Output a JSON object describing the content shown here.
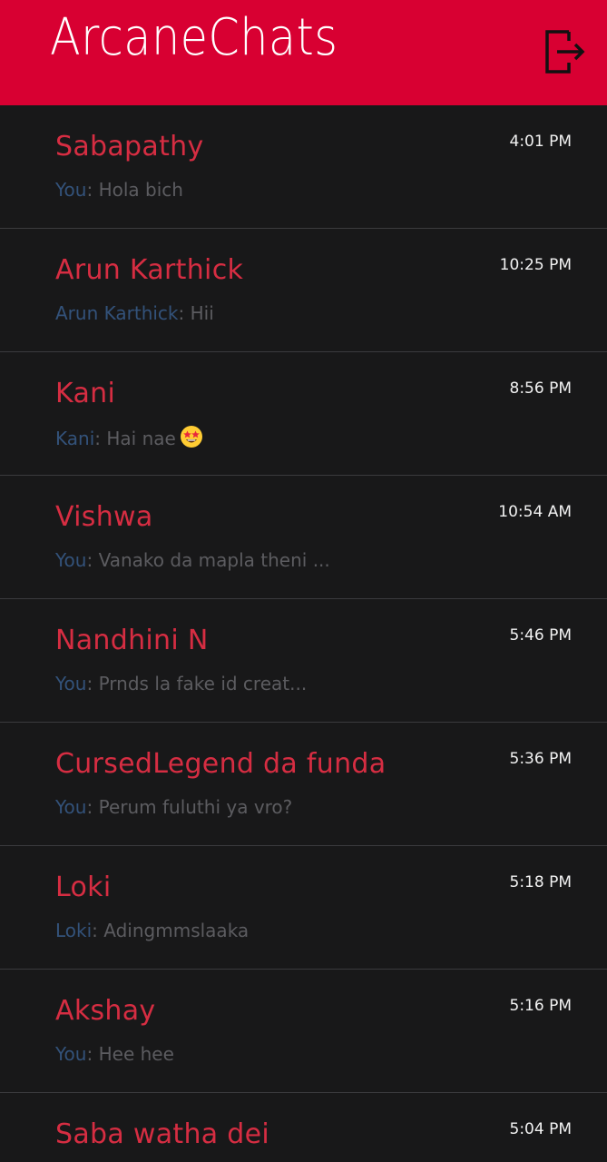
{
  "header": {
    "title": "ArcaneChats",
    "logout_icon": "logout-icon",
    "background": "#d80032"
  },
  "chats": [
    {
      "name": "Sabapathy",
      "time": "4:01 PM",
      "sender": "You",
      "message": "Hola bich"
    },
    {
      "name": "Arun Karthick",
      "time": "10:25 PM",
      "sender": "Arun Karthick",
      "message": "Hii"
    },
    {
      "name": "Kani",
      "time": "8:56 PM",
      "sender": "Kani",
      "message": "Hai nae",
      "emoji": "star-struck-emoji"
    },
    {
      "name": "Vishwa",
      "time": "10:54 AM",
      "sender": "You",
      "message": "Vanako da mapla theni ..."
    },
    {
      "name": "Nandhini N",
      "time": "5:46 PM",
      "sender": "You",
      "message": "Prnds la fake id creat..."
    },
    {
      "name": "CursedLegend da funda",
      "time": "5:36 PM",
      "sender": "You",
      "message": "Perum fuluthi ya vro?"
    },
    {
      "name": "Loki",
      "time": "5:18 PM",
      "sender": "Loki",
      "message": "Adingmmslaaka"
    },
    {
      "name": "Akshay",
      "time": "5:16 PM",
      "sender": "You",
      "message": "Hee hee"
    },
    {
      "name": "Saba watha dei",
      "time": "5:04 PM",
      "sender": "",
      "message": ""
    }
  ],
  "colors": {
    "accent": "#d80032",
    "name": "#d62d42",
    "sender": "#33527a",
    "preview": "#5c5c60",
    "background": "#181819",
    "divider": "#3b3b3e"
  }
}
